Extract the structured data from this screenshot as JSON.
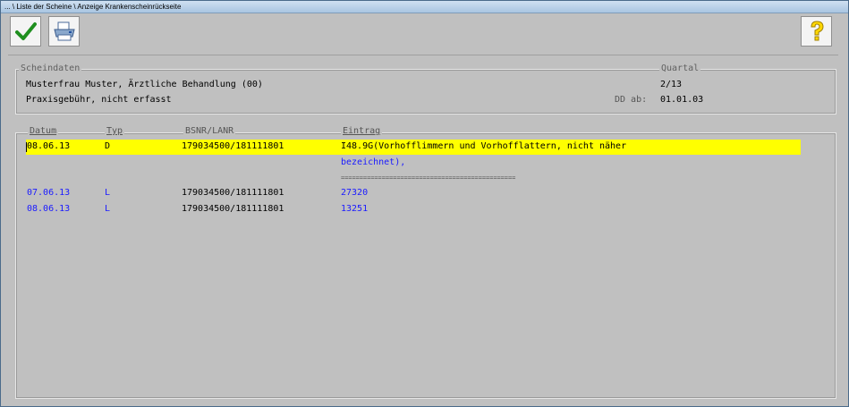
{
  "window": {
    "title": "... \\ Liste der Scheine \\ Anzeige Krankenscheinrückseite"
  },
  "toolbar": {
    "ok_icon": "checkmark-icon",
    "print_icon": "printer-icon",
    "help_icon": "help-icon"
  },
  "scheindaten": {
    "legend": "Scheindaten",
    "quartal_label": "Quartal",
    "patient": "Musterfrau Muster, Ärztliche Behandlung (00)",
    "praxisgebuehr": "Praxisgebühr, nicht erfasst",
    "quartal_value": "2/13",
    "dd_label": "DD ab:",
    "dd_value": "01.01.03"
  },
  "table": {
    "headers": [
      "Datum",
      "Typ",
      "BSNR/LANR",
      "Eintrag"
    ],
    "rows": [
      {
        "datum": "08.06.13",
        "typ": "D",
        "bsnr": "179034500/181111801",
        "eintrag": "I48.9G(Vorhofflimmern und Vorhofflattern, nicht näher",
        "eintrag2": "bezeichnet),"
      },
      {
        "separator": "==============================================="
      },
      {
        "datum": "07.06.13",
        "typ": "L",
        "bsnr": "179034500/181111801",
        "eintrag": "27320"
      },
      {
        "datum": "08.06.13",
        "typ": "L",
        "bsnr": "179034500/181111801",
        "eintrag": "13251"
      }
    ]
  },
  "colors": {
    "highlight": "#ffff00",
    "link_blue": "#1a1aff",
    "background": "#c0c0c0"
  }
}
